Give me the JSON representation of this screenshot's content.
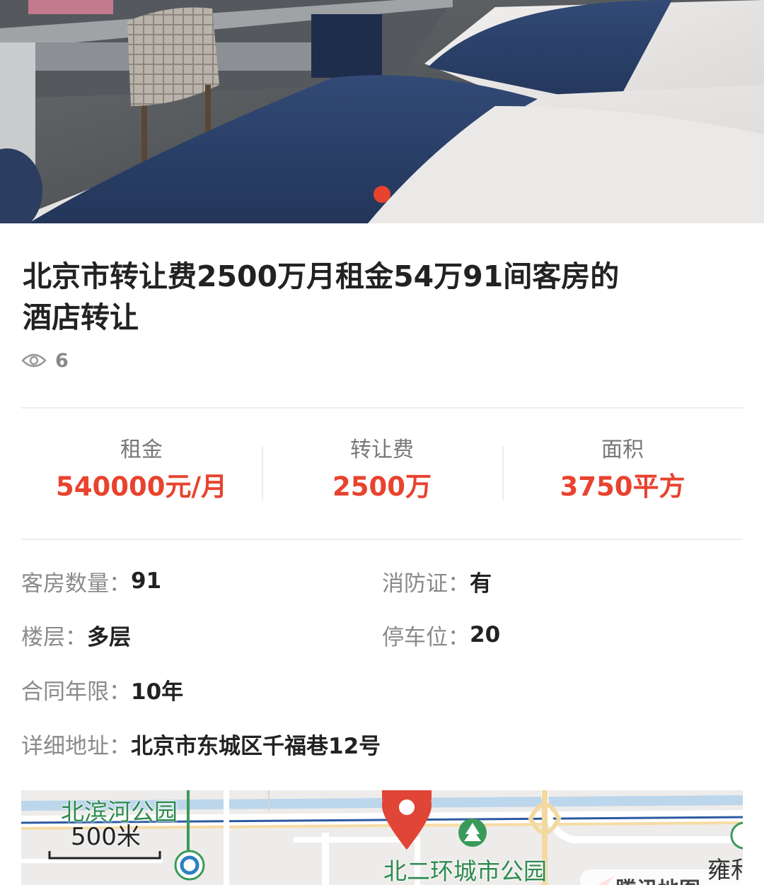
{
  "listing": {
    "title": "北京市转让费2500万月租金54万91间客房的酒店转让",
    "views": "6"
  },
  "gallery": {
    "active_dot_color": "#e8432e"
  },
  "stats": [
    {
      "label": "租金",
      "value": "540000元/月"
    },
    {
      "label": "转让费",
      "value": "2500万"
    },
    {
      "label": "面积",
      "value": "3750平方"
    }
  ],
  "details": {
    "rooms": {
      "label": "客房数量：",
      "value": "91"
    },
    "fire": {
      "label": "消防证：",
      "value": "有"
    },
    "floor": {
      "label": "楼层：",
      "value": "多层"
    },
    "parking": {
      "label": "停车位：",
      "value": "20"
    },
    "contract": {
      "label": "合同年限：",
      "value": "10年"
    },
    "address": {
      "label": "详细地址：",
      "value": "北京市东城区千福巷12号"
    }
  },
  "map": {
    "park_north": "北滨河公园",
    "scale": "500米",
    "park_ring": "北二环城市公园",
    "edge_text": "雍和",
    "brand": "腾讯地图"
  },
  "colors": {
    "accent": "#e8432e",
    "label_gray": "#8a8a8a",
    "park_green": "#2f8a4f"
  },
  "icons": [
    "eye-icon",
    "map-pin-icon",
    "park-icon",
    "metro-icon"
  ]
}
